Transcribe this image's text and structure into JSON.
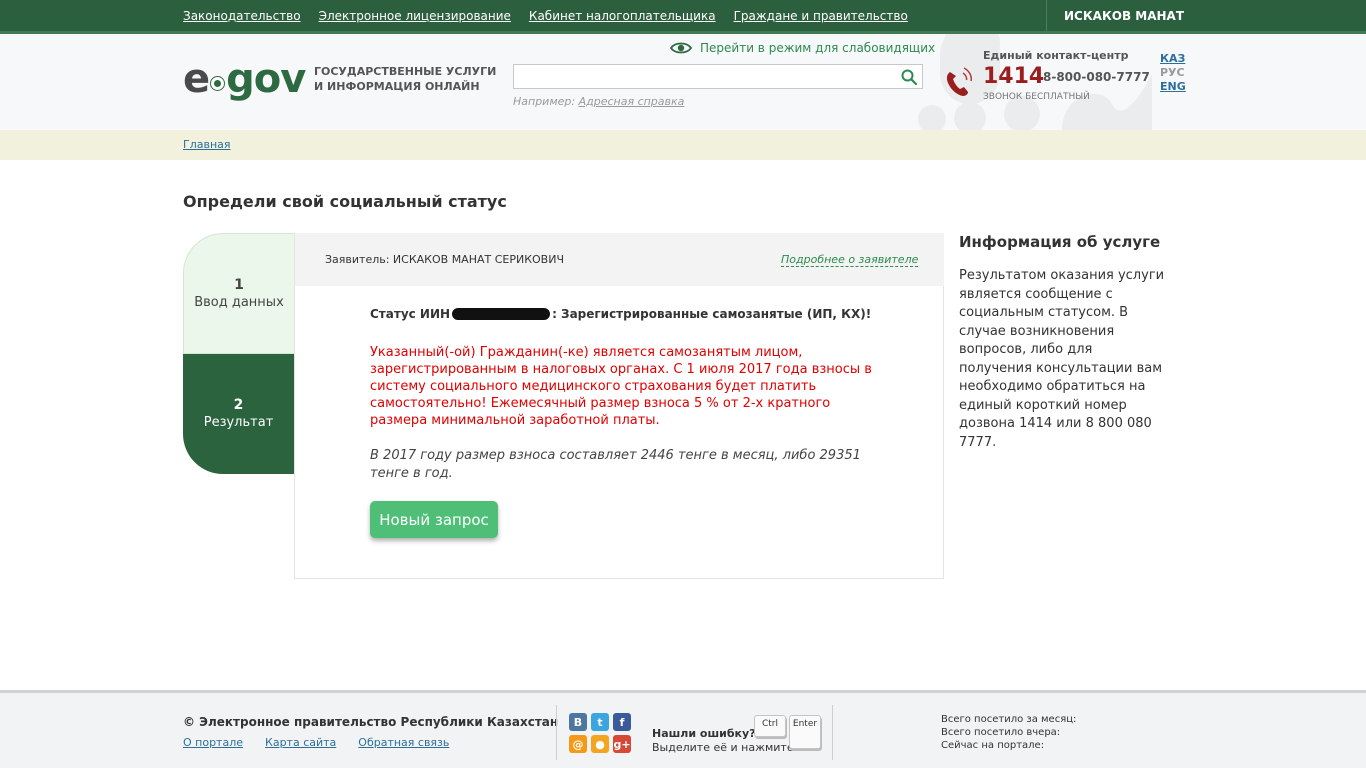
{
  "topbar": {
    "links": [
      "Законодательство",
      "Электронное лицензирование",
      "Кабинет налогоплательщика",
      "Граждане и правительство"
    ],
    "user": "ИСКАКОВ МАНАТ"
  },
  "header": {
    "logo_e": "e",
    "logo_gov": "gov",
    "slogan": "ГОСУДАРСТВЕННЫЕ УСЛУГИ И ИНФОРМАЦИЯ ОНЛАЙН",
    "low_vision": "Перейти в режим для слабовидящих",
    "search_value": "",
    "search_placeholder": "",
    "example_prefix": "Например:",
    "example_link": "Адресная справка",
    "contact_title": "Единый контакт-центр",
    "contact_short": "1414",
    "contact_long": "8-800-080-7777",
    "contact_free": "звонок бесплатный",
    "langs": [
      "КАЗ",
      "РУС",
      "ENG"
    ]
  },
  "breadcrumb": "Главная",
  "page_title": "Определи свой социальный статус",
  "steps": [
    {
      "num": "1",
      "label": "Ввод данных"
    },
    {
      "num": "2",
      "label": "Результат"
    }
  ],
  "result": {
    "applicant": "Заявитель: ИСКАКОВ МАНАТ СЕРИКОВИЧ",
    "applicant_more": "Подробнее о заявителе",
    "status_prefix": "Статус ИИН",
    "status_suffix": ": Зарегистрированные самозанятые (ИП, КХ)!",
    "status_red": "Указанный(-ой) Гражданин(-ке) является самозанятым лицом, зарегистрированным в налоговых органах. С 1 июля 2017 года взносы в систему социального медицинского страхования будет платить самостоятельно! Ежемесячный размер взноса 5 % от 2-х кратного размера минимальной заработной платы.",
    "status_note": "В 2017 году размер взноса составляет 2446 тенге в месяц, либо 29351 тенге в год.",
    "new_request": "Новый запрос"
  },
  "info": {
    "title": "Информация об услуге",
    "text": "Результатом оказания услуги является сообщение с социальным статусом. В случае возникновения вопросов, либо для получения консультации вам необходимо обратиться на единый короткий номер дозвона 1414 или 8 800 080 7777."
  },
  "footer": {
    "copyright": "© Электронное правительство Республики Казахстан",
    "links": [
      "О портале",
      "Карта сайта",
      "Обратная связь"
    ],
    "social": [
      {
        "glyph": "В",
        "color": "#4d76a1"
      },
      {
        "glyph": "t",
        "color": "#3aa5de"
      },
      {
        "glyph": "f",
        "color": "#3b5a9a"
      },
      {
        "glyph": "@",
        "color": "#f59a16"
      },
      {
        "glyph": "●",
        "color": "#f4a51f"
      },
      {
        "glyph": "g+",
        "color": "#d64937"
      }
    ],
    "found_error": "Нашли ошибку?",
    "select_press": "Выделите её и нажмите",
    "key_ctrl": "Ctrl",
    "key_enter": "Enter",
    "stats": [
      "Всего посетило за месяц:",
      "Всего посетило вчера:",
      "Сейчас на портале:"
    ]
  },
  "colors": {
    "brand_green": "#2b5f3d",
    "accent_green": "#4fbf78",
    "alert_red": "#e00000",
    "phone_red": "#9b1e1e"
  }
}
